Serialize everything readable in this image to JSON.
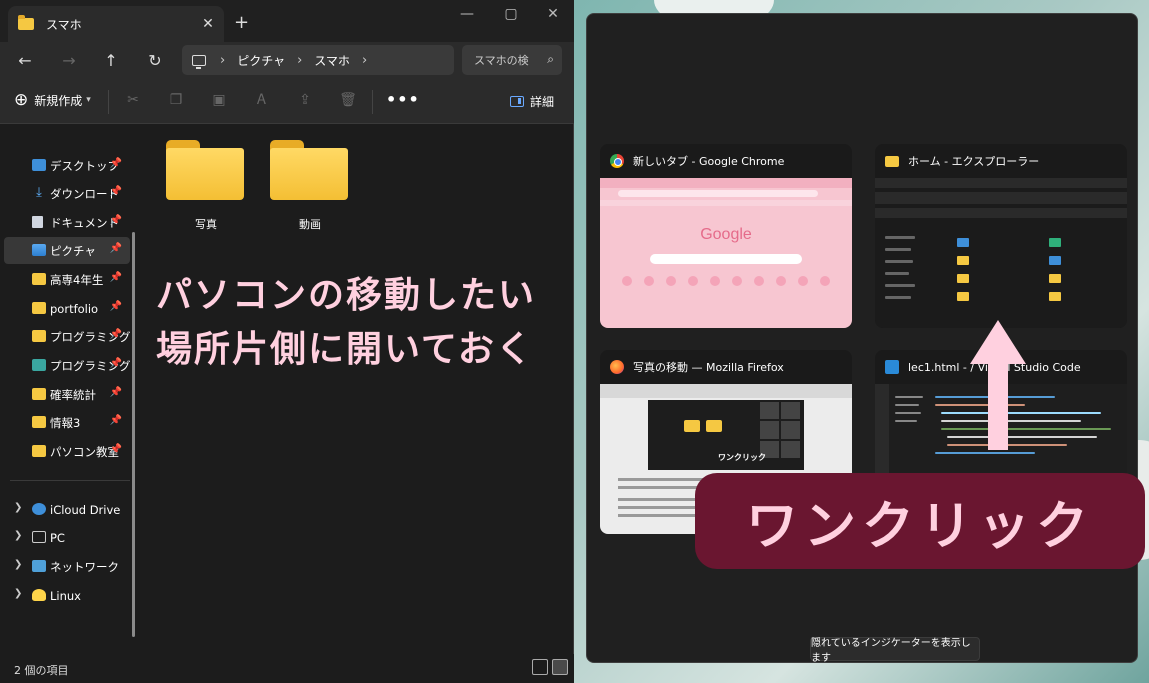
{
  "explorer": {
    "tab_title": "スマホ",
    "tab_close": "✕",
    "tab_new": "+",
    "window_controls": [
      "—",
      "▢",
      "✕"
    ],
    "breadcrumb": [
      "ピクチャ",
      "スマホ"
    ],
    "search_placeholder": "スマホの検",
    "new_label": "新規作成",
    "details_label": "詳細",
    "more_label": "•••",
    "sidebar": {
      "quick_access": [
        {
          "label": "デスクトップ",
          "icon": "desktop-icon",
          "pinned": true
        },
        {
          "label": "ダウンロード",
          "icon": "download-icon",
          "pinned": true
        },
        {
          "label": "ドキュメント",
          "icon": "document-icon",
          "pinned": true
        },
        {
          "label": "ピクチャ",
          "icon": "pictures-icon",
          "pinned": true,
          "selected": true
        },
        {
          "label": "高専4年生",
          "icon": "folder-icon",
          "pinned": true
        },
        {
          "label": "portfolio",
          "icon": "folder-icon",
          "pinned": true
        },
        {
          "label": "プログラミング研",
          "icon": "folder-icon",
          "pinned": true
        },
        {
          "label": "プログラミング製",
          "icon": "folder-icon",
          "pinned": true
        },
        {
          "label": "確率統計",
          "icon": "folder-icon",
          "pinned": true
        },
        {
          "label": "情報3",
          "icon": "folder-icon",
          "pinned": true
        },
        {
          "label": "パソコン教室",
          "icon": "folder-icon",
          "pinned": true
        }
      ],
      "drives": [
        {
          "label": "iCloud Drive",
          "icon": "icloud-icon"
        },
        {
          "label": "PC",
          "icon": "pc-icon"
        },
        {
          "label": "ネットワーク",
          "icon": "network-icon"
        },
        {
          "label": "Linux",
          "icon": "linux-icon"
        }
      ]
    },
    "folders": [
      {
        "label": "写真"
      },
      {
        "label": "動画"
      }
    ],
    "status_text": "2 個の項目",
    "annotation_lines": [
      "パソコンの移動したい",
      "場所片側に開いておく"
    ]
  },
  "snap": {
    "windows": [
      {
        "title": "新しいタブ - Google Chrome",
        "app": "chrome"
      },
      {
        "title": "ホーム - エクスプローラー",
        "app": "explorer"
      },
      {
        "title": "写真の移動 — Mozilla Firefox",
        "app": "firefox"
      },
      {
        "title": "lec1.html - /                    Visual Studio Code",
        "app": "vscode"
      }
    ],
    "chrome_logo": "Google",
    "firefox_thumb_label": "ワンクリック",
    "hint": "隠れているインジケーターを表示します",
    "callout": "ワンクリック"
  },
  "colors": {
    "annotation_pink": "#ffd0df",
    "callout_bg": "#6a1630",
    "folder_yellow": "#f5c842"
  }
}
